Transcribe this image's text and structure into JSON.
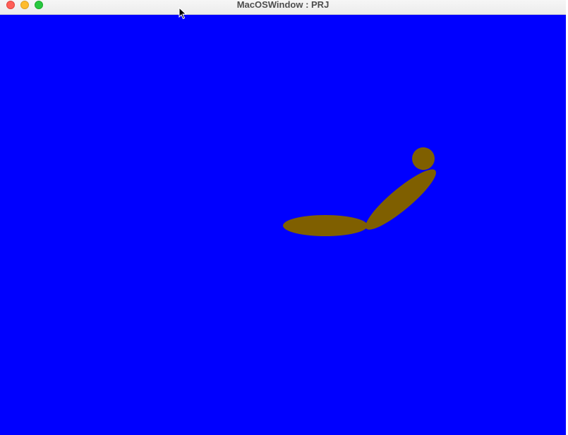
{
  "window": {
    "title": "MacOSWindow : PRJ"
  },
  "title_bar": {
    "buttons": [
      {
        "name": "close",
        "color": "#ff5f57"
      },
      {
        "name": "minimize",
        "color": "#febc2e"
      },
      {
        "name": "zoom",
        "color": "#28c840"
      }
    ]
  },
  "scene": {
    "background_color": "#0000ff",
    "figure_color": "#7f5f00"
  }
}
